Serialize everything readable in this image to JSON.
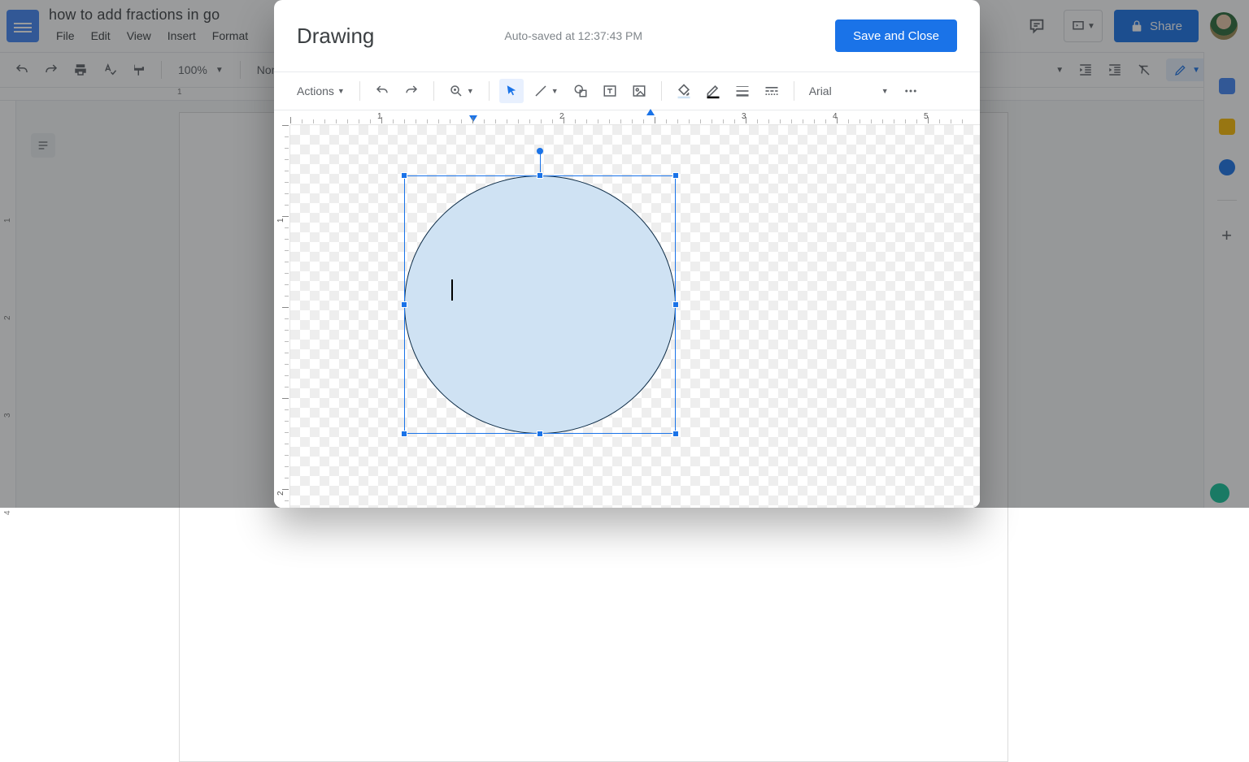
{
  "docs": {
    "title": "how to add fractions in go",
    "menubar": [
      "File",
      "Edit",
      "View",
      "Insert",
      "Format"
    ],
    "share_label": "Share",
    "toolbar": {
      "zoom": "100%",
      "style": "Norr"
    },
    "h_ruler_tick": "1",
    "v_ruler_ticks": [
      "1",
      "2",
      "3",
      "4"
    ]
  },
  "modal": {
    "title": "Drawing",
    "autosave": "Auto-saved at 12:37:43 PM",
    "save_label": "Save and Close",
    "actions_label": "Actions",
    "font": "Arial",
    "h_ruler_ticks": [
      "1",
      "2",
      "3",
      "4",
      "5"
    ],
    "v_ruler_ticks": [
      "1",
      "2"
    ]
  },
  "shape": {
    "type": "ellipse",
    "fill": "#cfe2f3",
    "stroke": "#0b2a45"
  }
}
